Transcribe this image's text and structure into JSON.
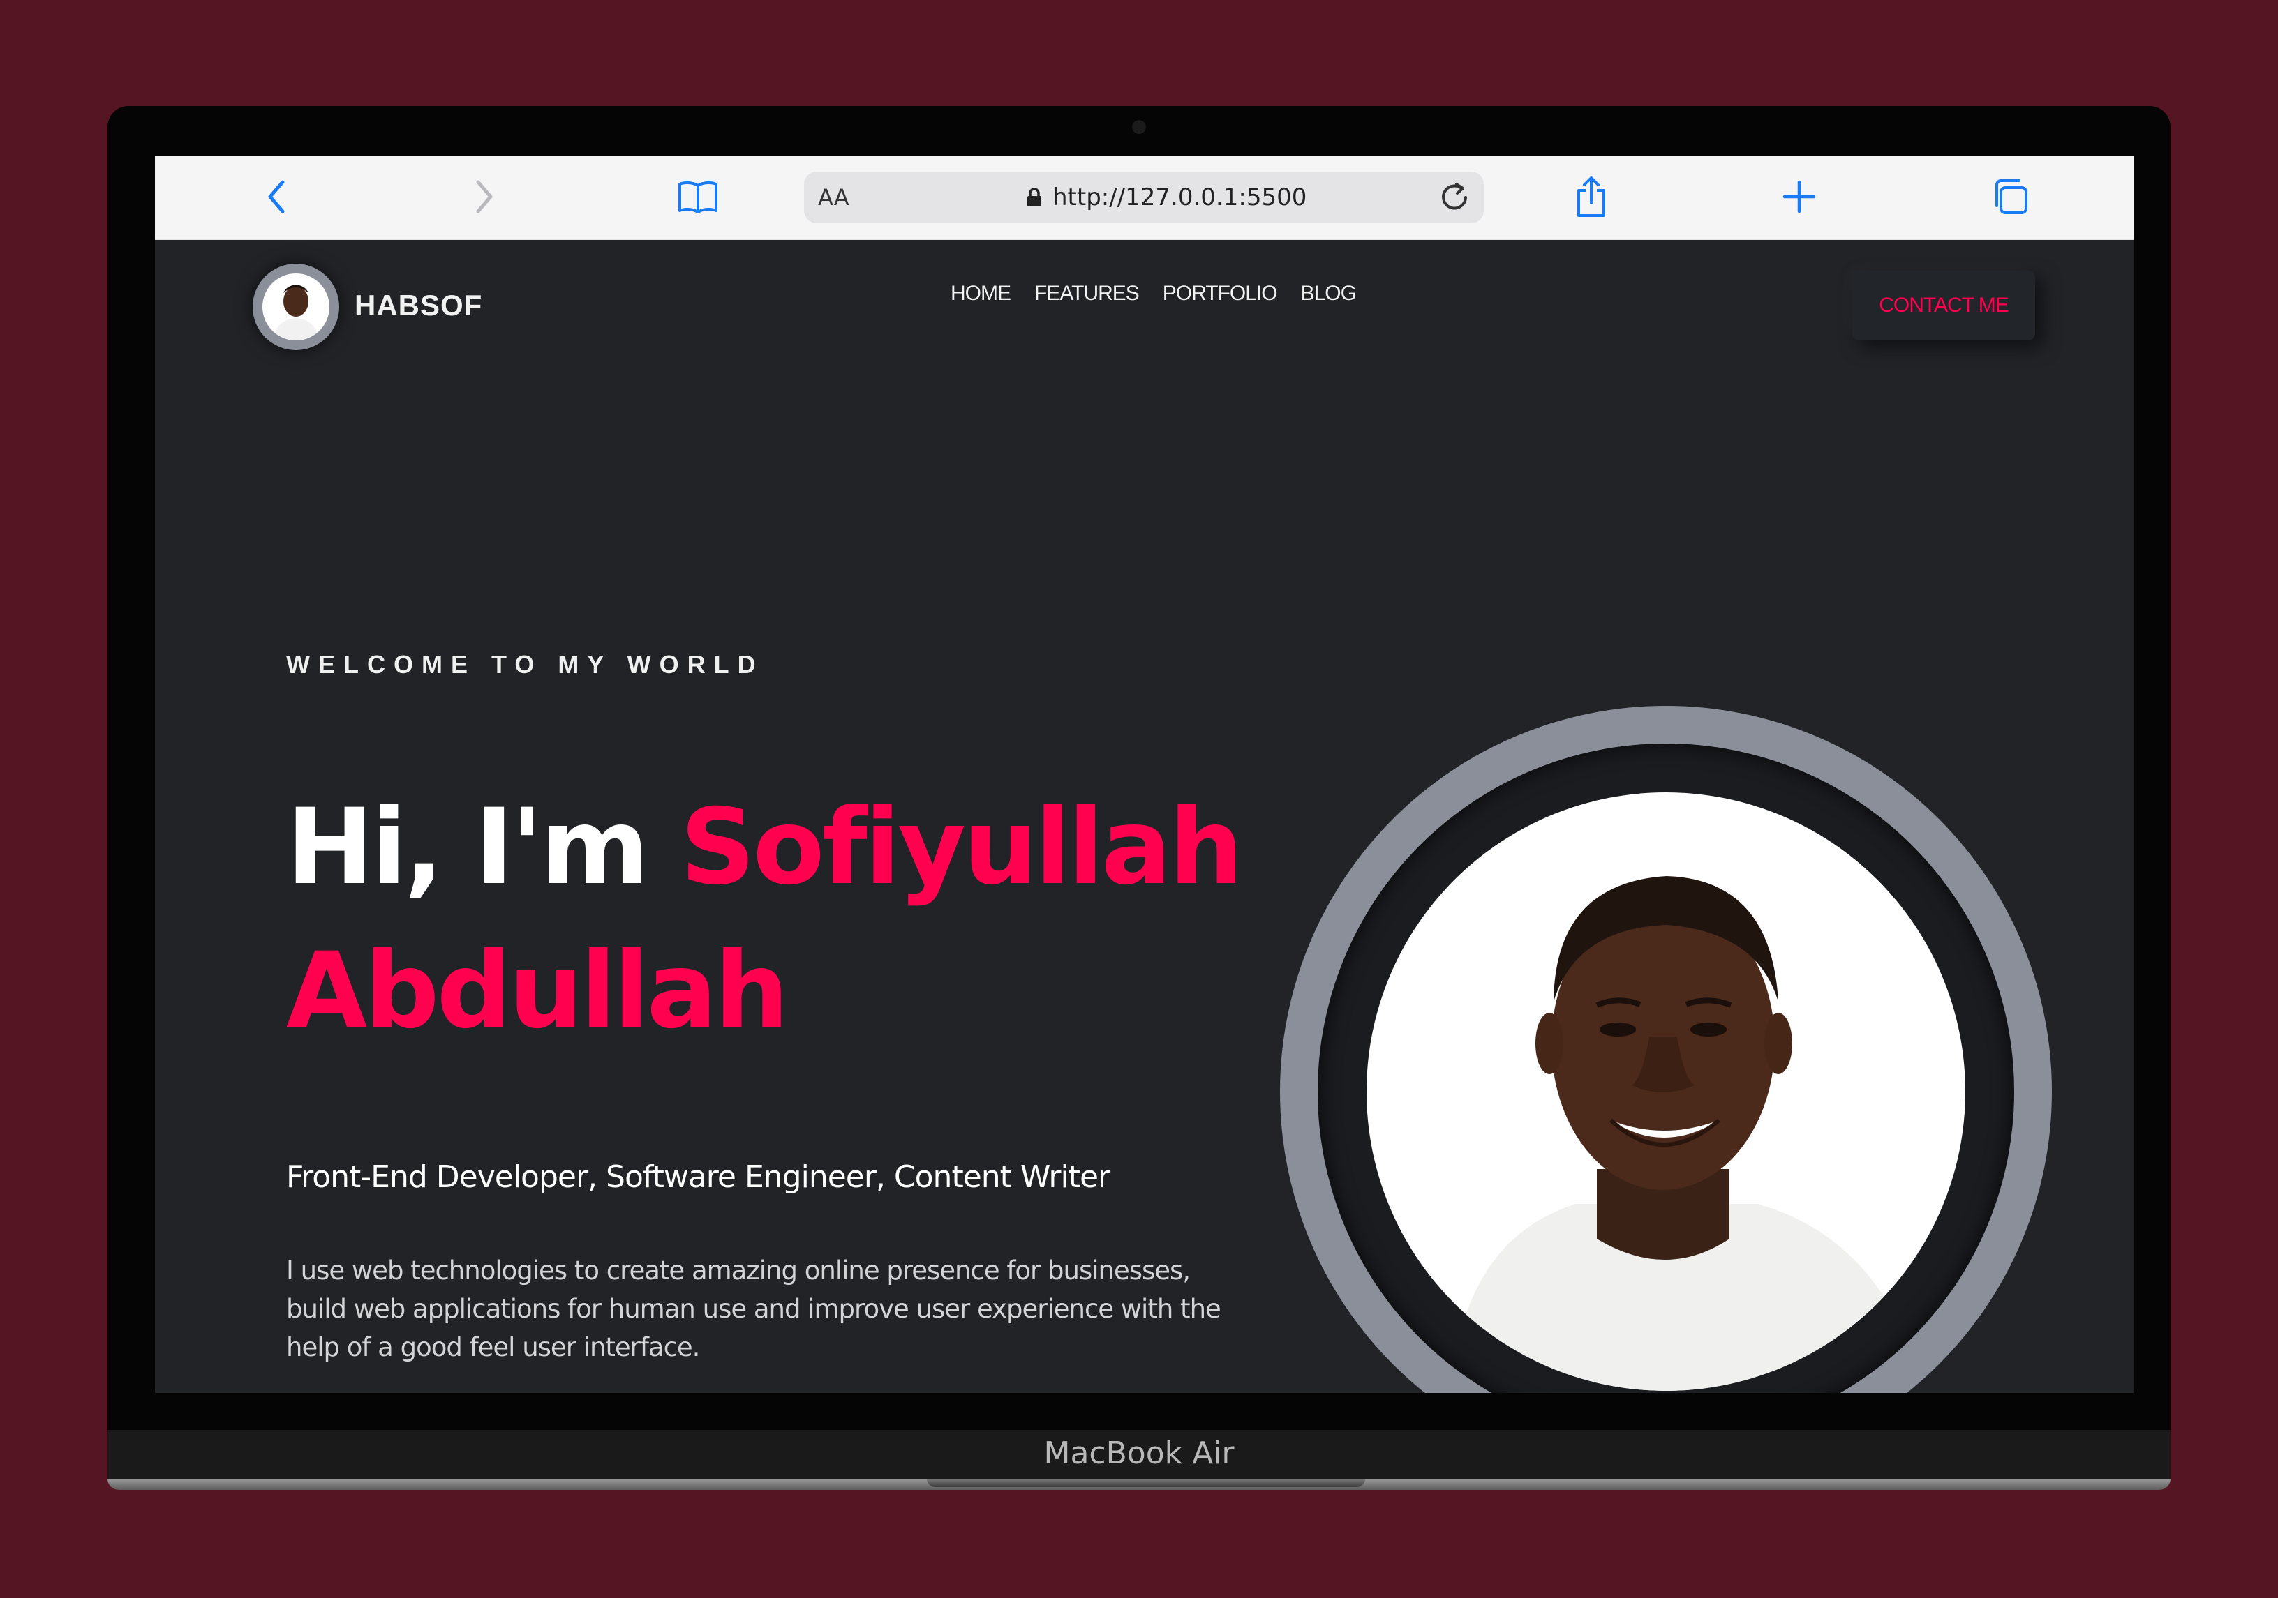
{
  "browser": {
    "text_size_label": "AA",
    "url": "http://127.0.0.1:5500"
  },
  "site": {
    "logo": "HABSOF",
    "nav": [
      "HOME",
      "FEATURES",
      "PORTFOLIO",
      "BLOG"
    ],
    "contact_label": "CONTACT ME",
    "accent": "#ff014f",
    "background": "#212327"
  },
  "hero": {
    "welcome": "WELCOME TO MY WORLD",
    "greeting": "Hi, I'm",
    "name_first": "Sofiyullah",
    "name_last": "Abdullah",
    "roles": "Front-End Developer, Software Engineer, Content Writer",
    "bio": "I use web technologies to create amazing online presence for businesses, build web applications for human use and improve user experience with the help of a good feel user interface."
  },
  "device": {
    "label": "MacBook Air"
  },
  "page_background": "#561522"
}
